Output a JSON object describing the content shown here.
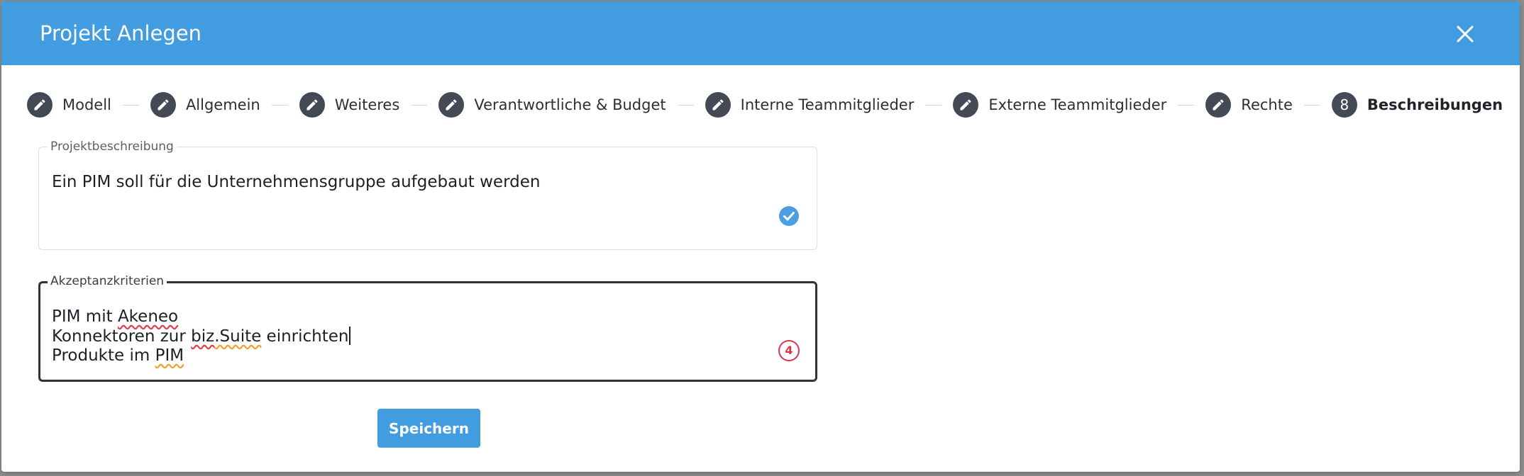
{
  "dialog": {
    "title": "Projekt Anlegen",
    "close_icon": "close-icon",
    "header_color": "#419ce0"
  },
  "stepper": {
    "steps": [
      {
        "label": "Modell",
        "icon": "pencil-icon",
        "state": "completed"
      },
      {
        "label": "Allgemein",
        "icon": "pencil-icon",
        "state": "completed"
      },
      {
        "label": "Weiteres",
        "icon": "pencil-icon",
        "state": "completed"
      },
      {
        "label": "Verantwortliche & Budget",
        "icon": "pencil-icon",
        "state": "completed"
      },
      {
        "label": "Interne Teammitglieder",
        "icon": "pencil-icon",
        "state": "completed"
      },
      {
        "label": "Externe Teammitglieder",
        "icon": "pencil-icon",
        "state": "completed"
      },
      {
        "label": "Rechte",
        "icon": "pencil-icon",
        "state": "completed"
      },
      {
        "label": "Beschreibungen",
        "number": "8",
        "state": "active"
      }
    ]
  },
  "form": {
    "description": {
      "label": "Projektbeschreibung",
      "value": "Ein PIM soll für die Unternehmensgruppe aufgebaut werden",
      "status_icon": "check-circle-icon"
    },
    "criteria": {
      "label": "Akzeptanzkriterien",
      "lines": {
        "l1_a": "PIM mit ",
        "l1_b": "Akeneo",
        "l2_a": "Konnekt",
        "l2_b": "oren zur ",
        "l2_c": "biz",
        "l2_d": ".Suite",
        "l2_e": " einrichten",
        "l3_a": "Produkte im ",
        "l3_b": "PIM"
      },
      "issue_count": "4"
    },
    "save_label": "Speichern"
  }
}
